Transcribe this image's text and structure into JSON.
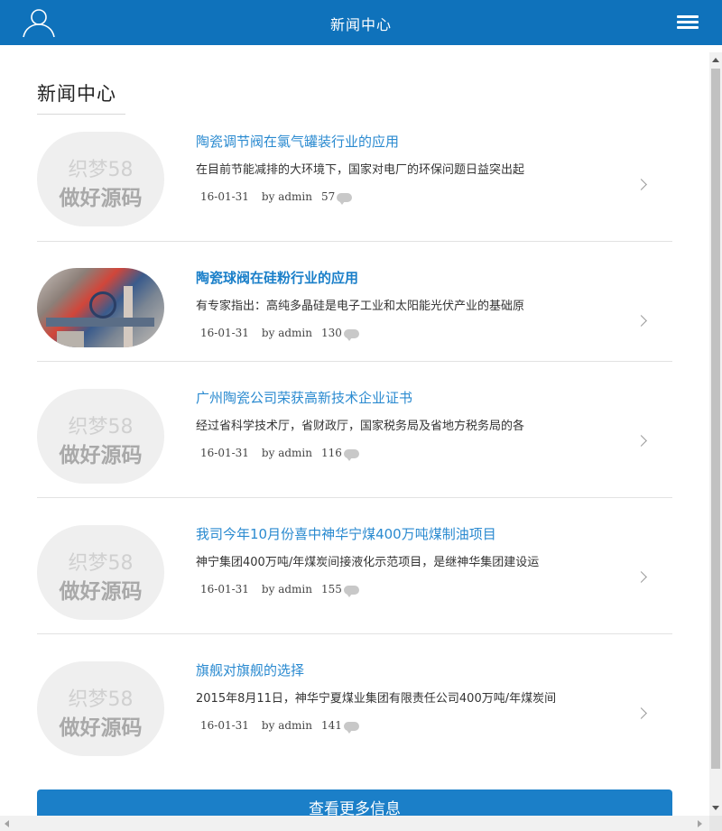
{
  "header": {
    "title": "新闻中心",
    "user_icon": "user-icon",
    "menu_icon": "hamburger-menu-icon",
    "background": "#0f72bb"
  },
  "section": {
    "title": "新闻中心"
  },
  "watermark": {
    "line1": "织梦58",
    "line2": "做好源码"
  },
  "news": [
    {
      "title": "陶瓷调节阀在氯气罐装行业的应用",
      "summary": "在目前节能减排的大环境下，国家对电厂的环保问题日益突出起",
      "date": "16-01-31",
      "author": "by admin",
      "comments": "57",
      "thumbnail": "placeholder"
    },
    {
      "title": "陶瓷球阀在硅粉行业的应用",
      "summary": "有专家指出：高纯多晶硅是电子工业和太阳能光伏产业的基础原",
      "date": "16-01-31",
      "author": "by admin",
      "comments": "130",
      "thumbnail": "photo"
    },
    {
      "title": "广州陶瓷公司荣获高新技术企业证书",
      "summary": "经过省科学技术厅，省财政厅，国家税务局及省地方税务局的各",
      "date": "16-01-31",
      "author": "by admin",
      "comments": "116",
      "thumbnail": "placeholder"
    },
    {
      "title": "我司今年10月份喜中神华宁煤400万吨煤制油项目",
      "summary": "神宁集团400万吨/年煤炭间接液化示范项目，是继神华集团建设运",
      "date": "16-01-31",
      "author": "by admin",
      "comments": "155",
      "thumbnail": "placeholder"
    },
    {
      "title": "旗舰对旗舰的选择",
      "summary": "2015年8月11日，神华宁夏煤业集团有限责任公司400万吨/年煤炭间",
      "date": "16-01-31",
      "author": "by admin",
      "comments": "141",
      "thumbnail": "placeholder"
    }
  ],
  "more_button": {
    "label": "查看更多信息"
  },
  "colors": {
    "accent": "#1b7fc8",
    "link": "#2a8ad0"
  }
}
